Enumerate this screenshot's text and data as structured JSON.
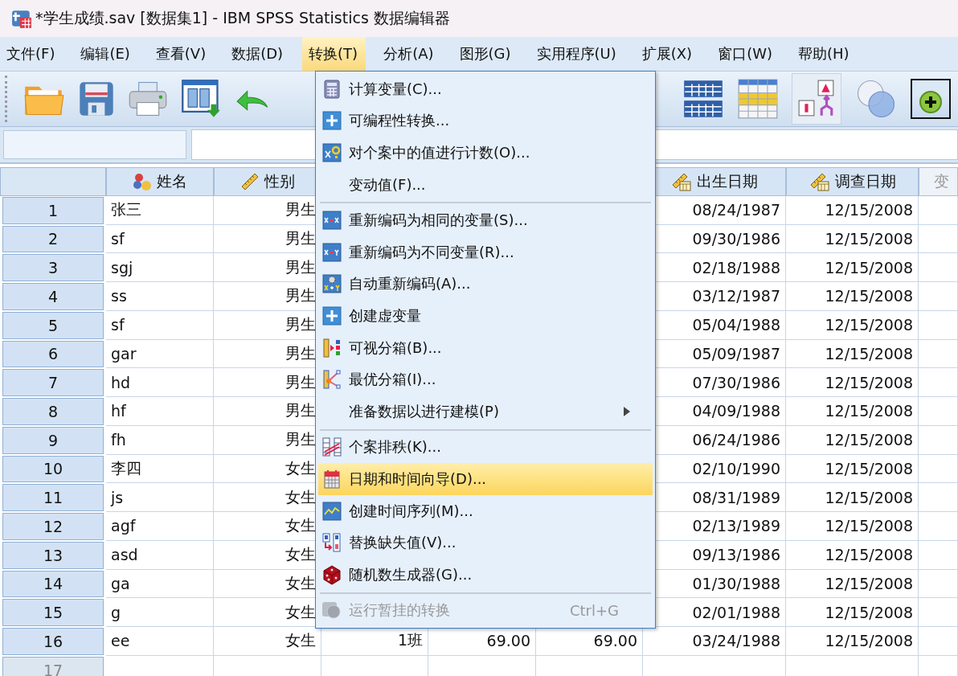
{
  "window": {
    "title": "*学生成绩.sav [数据集1] - IBM SPSS Statistics 数据编辑器"
  },
  "menubar": [
    {
      "label": "文件(F)",
      "selected": false
    },
    {
      "label": "编辑(E)",
      "selected": false
    },
    {
      "label": "查看(V)",
      "selected": false
    },
    {
      "label": "数据(D)",
      "selected": false
    },
    {
      "label": "转换(T)",
      "selected": true
    },
    {
      "label": "分析(A)",
      "selected": false
    },
    {
      "label": "图形(G)",
      "selected": false
    },
    {
      "label": "实用程序(U)",
      "selected": false
    },
    {
      "label": "扩展(X)",
      "selected": false
    },
    {
      "label": "窗口(W)",
      "selected": false
    },
    {
      "label": "帮助(H)",
      "selected": false
    }
  ],
  "columns_left": [
    {
      "label": "姓名",
      "kind": "string"
    },
    {
      "label": "性别",
      "kind": "scale"
    }
  ],
  "columns_right": [
    {
      "label": "出生日期",
      "kind": "date"
    },
    {
      "label": "调查日期",
      "kind": "date"
    },
    {
      "label": "变",
      "kind": "empty"
    }
  ],
  "rows": [
    {
      "number": "1",
      "name": "张三",
      "sex": "男生",
      "birth": "08/24/1987",
      "survey": "12/15/2008",
      "empty": false
    },
    {
      "number": "2",
      "name": "sf",
      "sex": "男生",
      "birth": "09/30/1986",
      "survey": "12/15/2008",
      "empty": false
    },
    {
      "number": "3",
      "name": "sgj",
      "sex": "男生",
      "birth": "02/18/1988",
      "survey": "12/15/2008",
      "empty": false
    },
    {
      "number": "4",
      "name": "ss",
      "sex": "男生",
      "birth": "03/12/1987",
      "survey": "12/15/2008",
      "empty": false
    },
    {
      "number": "5",
      "name": "sf",
      "sex": "男生",
      "birth": "05/04/1988",
      "survey": "12/15/2008",
      "empty": false
    },
    {
      "number": "6",
      "name": "gar",
      "sex": "男生",
      "birth": "05/09/1987",
      "survey": "12/15/2008",
      "empty": false
    },
    {
      "number": "7",
      "name": "hd",
      "sex": "男生",
      "birth": "07/30/1986",
      "survey": "12/15/2008",
      "empty": false
    },
    {
      "number": "8",
      "name": "hf",
      "sex": "男生",
      "birth": "04/09/1988",
      "survey": "12/15/2008",
      "empty": false
    },
    {
      "number": "9",
      "name": "fh",
      "sex": "男生",
      "birth": "06/24/1986",
      "survey": "12/15/2008",
      "empty": false
    },
    {
      "number": "10",
      "name": "李四",
      "sex": "女生",
      "birth": "02/10/1990",
      "survey": "12/15/2008",
      "empty": false
    },
    {
      "number": "11",
      "name": "js",
      "sex": "女生",
      "birth": "08/31/1989",
      "survey": "12/15/2008",
      "empty": false
    },
    {
      "number": "12",
      "name": "agf",
      "sex": "女生",
      "birth": "02/13/1989",
      "survey": "12/15/2008",
      "empty": false
    },
    {
      "number": "13",
      "name": "asd",
      "sex": "女生",
      "birth": "09/13/1986",
      "survey": "12/15/2008",
      "empty": false
    },
    {
      "number": "14",
      "name": "ga",
      "sex": "女生",
      "birth": "01/30/1988",
      "survey": "12/15/2008",
      "empty": false
    },
    {
      "number": "15",
      "name": "g",
      "sex": "女生",
      "birth": "02/01/1988",
      "survey": "12/15/2008",
      "empty": false
    },
    {
      "number": "16",
      "name": "ee",
      "sex": "女生",
      "column_3": "1班",
      "column_4": "69.00",
      "column_5": "69.00",
      "birth": "03/24/1988",
      "survey": "12/15/2008",
      "empty": false
    },
    {
      "number": "17",
      "empty": true
    }
  ],
  "menu": {
    "sections": [
      {
        "items": [
          {
            "label": "计算变量(C)...",
            "selected": false,
            "disabled": false,
            "submenu": false
          },
          {
            "label": "可编程性转换...",
            "selected": false,
            "disabled": false,
            "submenu": false
          },
          {
            "label": "对个案中的值进行计数(O)...",
            "selected": false,
            "disabled": false,
            "submenu": false
          },
          {
            "label": "变动值(F)...",
            "selected": false,
            "disabled": false,
            "submenu": false
          }
        ]
      },
      {
        "items": [
          {
            "label": "重新编码为相同的变量(S)...",
            "selected": false,
            "disabled": false,
            "submenu": false
          },
          {
            "label": "重新编码为不同变量(R)...",
            "selected": false,
            "disabled": false,
            "submenu": false
          },
          {
            "label": "自动重新编码(A)...",
            "selected": false,
            "disabled": false,
            "submenu": false
          },
          {
            "label": "创建虚变量",
            "selected": false,
            "disabled": false,
            "submenu": false
          },
          {
            "label": "可视分箱(B)...",
            "selected": false,
            "disabled": false,
            "submenu": false
          },
          {
            "label": "最优分箱(I)...",
            "selected": false,
            "disabled": false,
            "submenu": false
          },
          {
            "label": "准备数据以进行建模(P)",
            "selected": false,
            "disabled": false,
            "submenu": true
          }
        ]
      },
      {
        "items": [
          {
            "label": "个案排秩(K)...",
            "selected": false,
            "disabled": false,
            "submenu": false
          },
          {
            "label": "日期和时间向导(D)...",
            "selected": true,
            "disabled": false,
            "submenu": false
          },
          {
            "label": "创建时间序列(M)...",
            "selected": false,
            "disabled": false,
            "submenu": false
          },
          {
            "label": "替换缺失值(V)...",
            "selected": false,
            "disabled": false,
            "submenu": false
          },
          {
            "label": "随机数生成器(G)...",
            "selected": false,
            "disabled": false,
            "submenu": false
          }
        ]
      },
      {
        "items": [
          {
            "label": "运行暂挂的转换",
            "selected": false,
            "disabled": true,
            "submenu": false,
            "shortcut": "Ctrl+G"
          }
        ]
      }
    ]
  }
}
